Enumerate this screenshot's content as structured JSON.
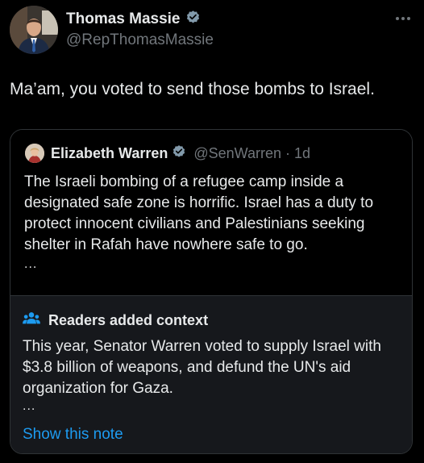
{
  "post": {
    "author": {
      "display_name": "Thomas Massie",
      "handle": "@RepThomasMassie",
      "verified_icon": "verified-badge-icon"
    },
    "text": "Ma’am, you voted to send those bombs to Israel."
  },
  "quoted_post": {
    "author": {
      "display_name": "Elizabeth Warren",
      "handle": "@SenWarren",
      "separator": "·",
      "time": "1d",
      "verified_icon": "verified-badge-icon"
    },
    "text": "The Israeli bombing of a refugee camp inside a designated safe zone is horrific. Israel has a duty to protect innocent civilians and Palestinians seeking shelter in Rafah have nowhere safe to go.",
    "truncation": "..."
  },
  "community_note": {
    "title": "Readers added context",
    "icon": "community-notes-icon",
    "text": "This year, Senator Warren voted to supply Israel with $3.8 billion of weapons, and defund the UN's aid organization for Gaza.",
    "truncation": "...",
    "link_label": "Show this note"
  },
  "colors": {
    "background": "#000000",
    "text": "#e7e9ea",
    "secondary_text": "#71767b",
    "link": "#1d9bf0",
    "verified": "#829aab",
    "note_background": "#16181c",
    "border": "#2f3336"
  }
}
